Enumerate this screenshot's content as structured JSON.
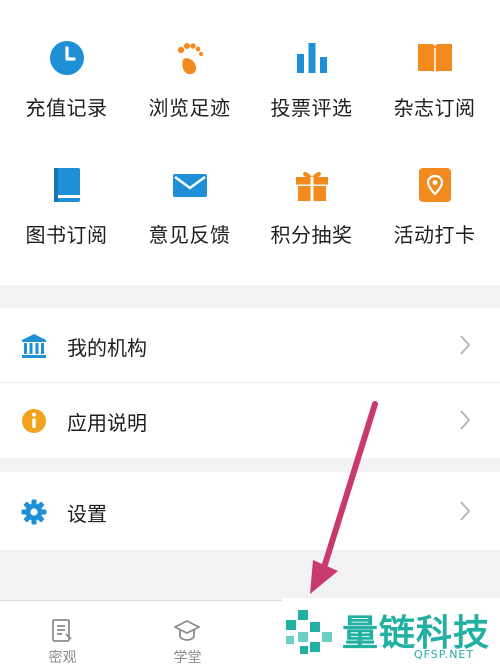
{
  "grid": {
    "row1": [
      "充值记录",
      "浏览足迹",
      "投票评选",
      "杂志订阅"
    ],
    "row2": [
      "图书订阅",
      "意见反馈",
      "积分抽奖",
      "活动打卡"
    ]
  },
  "list": {
    "institution": "我的机构",
    "app_guide": "应用说明",
    "settings": "设置"
  },
  "tabs": [
    "密观",
    "学堂"
  ],
  "watermark": {
    "brand": "量链科技",
    "site": "QFSP.NET"
  },
  "colors": {
    "blue": "#1f8fd6",
    "orange": "#f28a1e",
    "arrow": "#c83a6e",
    "watermark": "#21b0a2"
  },
  "icons": {
    "row1": [
      "clock-icon",
      "footprint-icon",
      "bar-chart-icon",
      "book-open-icon"
    ],
    "row2": [
      "book-icon",
      "mail-icon",
      "gift-icon",
      "location-pin-icon"
    ],
    "list": [
      "bank-icon",
      "info-icon",
      "gear-icon"
    ]
  }
}
